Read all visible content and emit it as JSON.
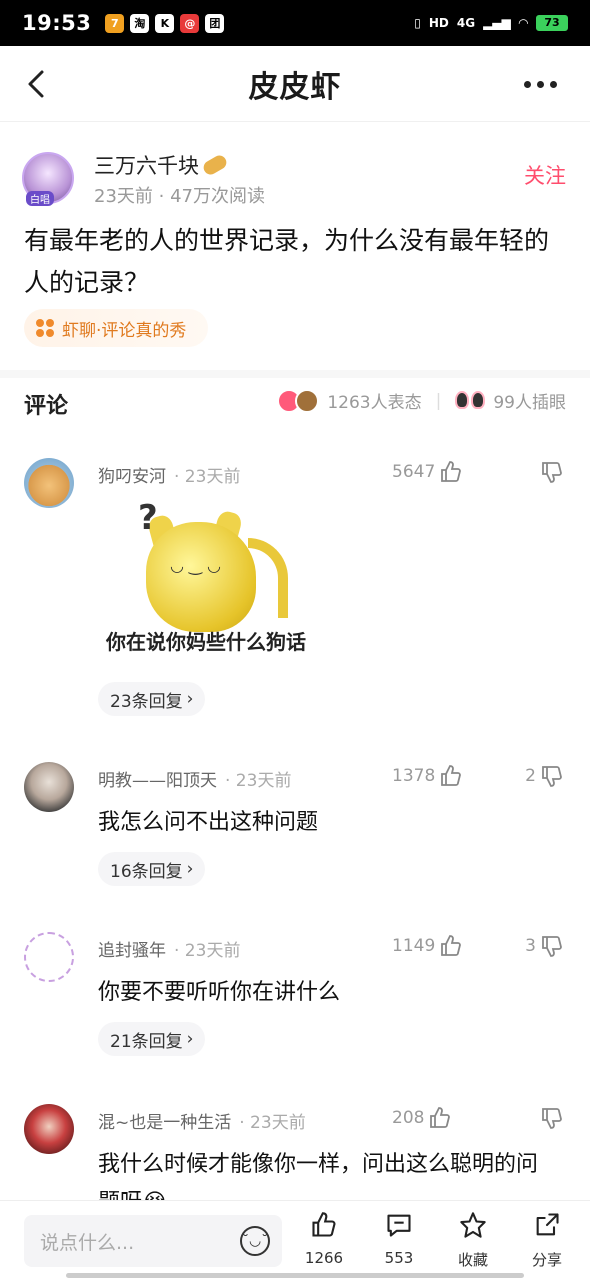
{
  "status_bar": {
    "time": "19:53",
    "apps": [
      "7",
      "淘",
      "K",
      "@",
      "团"
    ],
    "network": "4G",
    "battery": "73"
  },
  "nav": {
    "title": "皮皮虾"
  },
  "post": {
    "author": "三万六千块",
    "avatar_tag": "白唱",
    "meta": "23天前 · 47万次阅读",
    "follow_label": "关注",
    "title": "有最年老的人的世界记录，为什么没有最年轻的人的记录？",
    "topic": "虾聊·评论真的秀"
  },
  "comments_header": {
    "label": "评论",
    "reactions": "1263人表态",
    "eyes": "99人插眼"
  },
  "comments": [
    {
      "name": "狗叼安河",
      "time": "· 23天前",
      "likes": "5647",
      "dislikes": "",
      "meme_caption": "你在说你妈些什么狗话",
      "replies": "23条回复"
    },
    {
      "name": "明教——阳顶天",
      "time": "· 23天前",
      "likes": "1378",
      "dislikes": "2",
      "text": "我怎么问不出这种问题",
      "replies": "16条回复"
    },
    {
      "name": "追封骚年",
      "time": "· 23天前",
      "likes": "1149",
      "dislikes": "3",
      "text": "你要不要听听你在讲什么",
      "replies": "21条回复"
    },
    {
      "name": "混~也是一种生活",
      "time": "· 23天前",
      "likes": "208",
      "dislikes": "",
      "text": "我什么时候才能像你一样，问出这么聪明的问题呀😭"
    }
  ],
  "bottom_bar": {
    "input_placeholder": "说点什么...",
    "like_count": "1266",
    "comment_count": "553",
    "favorite_label": "收藏",
    "share_label": "分享"
  }
}
